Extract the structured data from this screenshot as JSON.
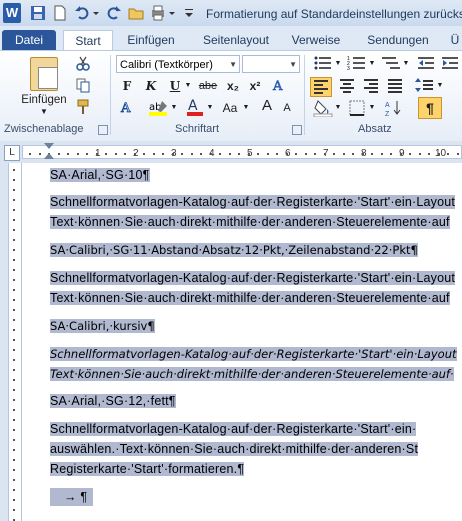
{
  "window": {
    "title": "Formatierung auf Standardeinstellungen zurückset",
    "app_logo": "W"
  },
  "qat": {
    "icons": [
      "save-icon",
      "new-document-icon",
      "undo-icon",
      "redo-icon",
      "open-icon",
      "print-preview-icon",
      "customize-qat-icon"
    ]
  },
  "ribbon_tabs": [
    {
      "label": "Datei"
    },
    {
      "label": "Start"
    },
    {
      "label": "Einfügen"
    },
    {
      "label": "Seitenlayout"
    },
    {
      "label": "Verweise"
    },
    {
      "label": "Sendungen"
    },
    {
      "label": "Ü"
    }
  ],
  "clipboard_group": {
    "label": "Zwischenablage",
    "paste_label": "Einfügen"
  },
  "font_group": {
    "label": "Schriftart",
    "font_name": "Calibri (Textkörper)",
    "font_size": "",
    "bold": "F",
    "italic": "K",
    "underline": "U",
    "strike": "abe",
    "subscript": "x₂",
    "superscript": "x²",
    "font_color": "A",
    "case": "Aa",
    "grow": "A",
    "shrink": "A"
  },
  "paragraph_group": {
    "label": "Absatz",
    "pilcrow": "¶"
  },
  "ruler": {
    "tab_selector": "L",
    "numbers": [
      "1",
      "2",
      "3",
      "4",
      "5",
      "6",
      "7",
      "8",
      "9",
      "10"
    ]
  },
  "document": {
    "lines": [
      {
        "text": "SA·Arial,·SG·10¶",
        "style": "arial"
      },
      {
        "text": "Schnellformatvorlagen-Katalog·auf·der·Registerkarte·'Start'·ein·Layout",
        "style": "arial"
      },
      {
        "text": "Text·können·Sie·auch·direkt·mithilfe·der·anderen·Steuerelemente·auf",
        "style": "arial"
      },
      {
        "text": "SA·Calibri,·SG·11·Abstand·Absatz·12·Pkt,·Zeilenabstand·22·Pkt¶",
        "style": "calibri"
      },
      {
        "text": "Schnellformatvorlagen-Katalog·auf·der·Registerkarte·'Start'·ein·Layout",
        "style": "arial"
      },
      {
        "text": "Text·können·Sie·auch·direkt·mithilfe·der·anderen·Steuerelemente·auf",
        "style": "arial"
      },
      {
        "text": "SA·Calibri,·kursiv¶",
        "style": "calibri"
      },
      {
        "text": "Schnellformatvorlagen-Katalog·auf·der·Registerkarte·'Start'·ein·Layout",
        "style": "calibri-italic"
      },
      {
        "text": "Text·können·Sie·auch·direkt·mithilfe·der·anderen·Steuerelemente·auf·",
        "style": "calibri-italic"
      },
      {
        "text": "SA·Arial,·SG·12,·fett¶",
        "style": "arial"
      },
      {
        "text": "Schnellformatvorlagen-Katalog·auf·der·Registerkarte·'Start'·ein·",
        "style": "arial"
      },
      {
        "text": "auswählen.·Text·können·Sie·auch·direkt·mithilfe·der·anderen·St",
        "style": "arial"
      },
      {
        "text": "Registerkarte·'Start'·formatieren.¶",
        "style": "arial"
      },
      {
        "text": "→   ¶",
        "style": "arial"
      }
    ]
  },
  "colors": {
    "selection": "#b0b9cf",
    "file_tab": "#2b579a",
    "highlight": "#ffff00",
    "font_color_red": "#e02020",
    "active_button": "#ffd36b"
  }
}
